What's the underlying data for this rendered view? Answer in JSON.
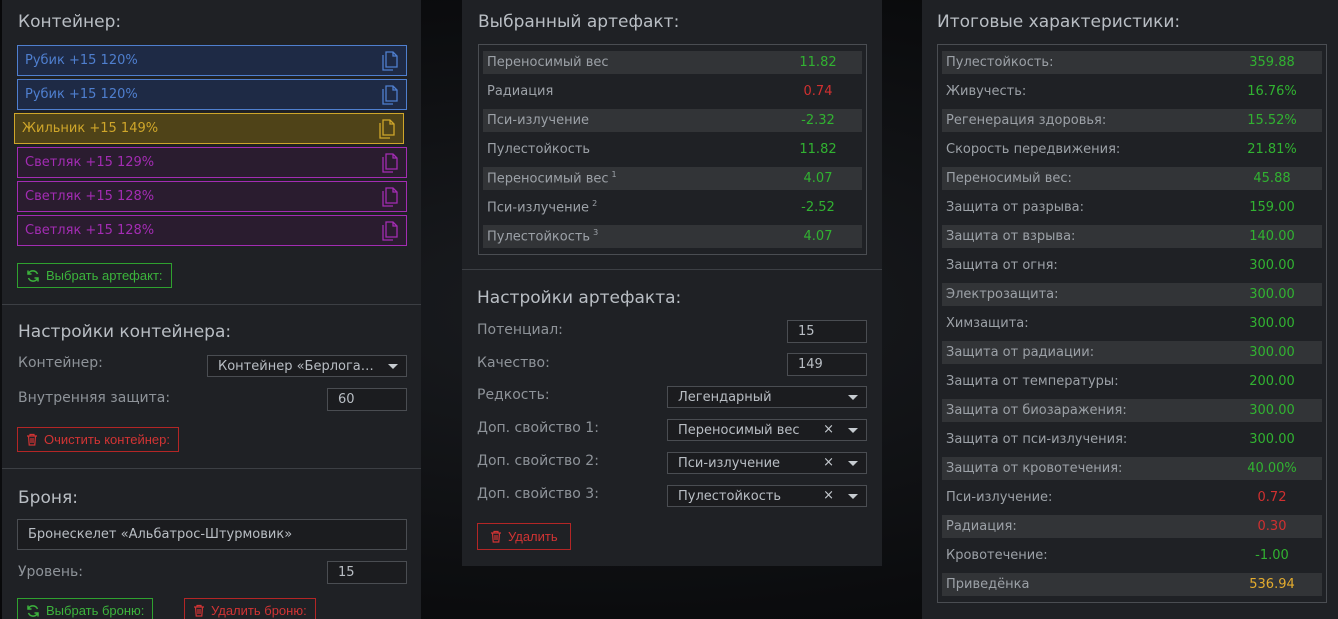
{
  "container": {
    "title": "Контейнер:",
    "artifacts": [
      {
        "label": "Рубик +15 120%",
        "color": "#4f7fcf",
        "bg": "#1e2a45"
      },
      {
        "label": "Рубик +15 120%",
        "color": "#4f7fcf",
        "bg": "#1e2a45"
      },
      {
        "label": "Жильник +15 149%",
        "color": "#cfa62a",
        "bg": "#4f4318"
      },
      {
        "label": "Светляк +15 129%",
        "color": "#a32cb3",
        "bg": "#2a1c2f"
      },
      {
        "label": "Светляк +15 128%",
        "color": "#a32cb3",
        "bg": "#2a1c2f"
      },
      {
        "label": "Светляк +15 128%",
        "color": "#a32cb3",
        "bg": "#2a1c2f"
      }
    ],
    "choose_artifact_label": "Выбрать артефакт:"
  },
  "container_settings": {
    "title": "Настройки контейнера:",
    "container_label": "Контейнер:",
    "container_value": "Контейнер «Берлога…",
    "inner_protection_label": "Внутренняя защита:",
    "inner_protection_value": "60",
    "clear_label": "Очистить контейнер:"
  },
  "armor": {
    "title": "Броня:",
    "name_value": "Бронескелет «Альбатрос-Штурмовик»",
    "level_label": "Уровень:",
    "level_value": "15",
    "choose_label": "Выбрать броню:",
    "delete_label": "Удалить броню:"
  },
  "selected": {
    "title": "Выбранный артефакт:",
    "rows": [
      {
        "key": "Переносимый вес",
        "sup": "",
        "value": "11.82",
        "tone": "green"
      },
      {
        "key": "Радиация",
        "sup": "",
        "value": "0.74",
        "tone": "red"
      },
      {
        "key": "Пси-излучение",
        "sup": "",
        "value": "-2.32",
        "tone": "green"
      },
      {
        "key": "Пулестойкость",
        "sup": "",
        "value": "11.82",
        "tone": "green"
      },
      {
        "key": "Переносимый вес",
        "sup": "1",
        "value": "4.07",
        "tone": "green"
      },
      {
        "key": "Пси-излучение",
        "sup": "2",
        "value": "-2.52",
        "tone": "green"
      },
      {
        "key": "Пулестойкость",
        "sup": "3",
        "value": "4.07",
        "tone": "green"
      }
    ]
  },
  "art_settings": {
    "title": "Настройки артефакта:",
    "potential_label": "Потенциал:",
    "potential_value": "15",
    "quality_label": "Качество:",
    "quality_value": "149",
    "rarity_label": "Редкость:",
    "rarity_value": "Легендарный",
    "extra1_label": "Доп. свойство 1:",
    "extra1_value": "Переносимый вес",
    "extra2_label": "Доп. свойство 2:",
    "extra2_value": "Пси-излучение",
    "extra3_label": "Доп. свойство 3:",
    "extra3_value": "Пулестойкость",
    "clear_glyph": "×",
    "delete_label": "Удалить"
  },
  "totals": {
    "title": "Итоговые характеристики:",
    "rows": [
      {
        "key": "Пулестойкость:",
        "value": "359.88",
        "tone": "green"
      },
      {
        "key": "Живучесть:",
        "value": "16.76%",
        "tone": "green"
      },
      {
        "key": "Регенерация здоровья:",
        "value": "15.52%",
        "tone": "green"
      },
      {
        "key": "Скорость передвижения:",
        "value": "21.81%",
        "tone": "green"
      },
      {
        "key": "Переносимый вес:",
        "value": "45.88",
        "tone": "green"
      },
      {
        "key": "Защита от разрыва:",
        "value": "159.00",
        "tone": "green"
      },
      {
        "key": "Защита от взрыва:",
        "value": "140.00",
        "tone": "green"
      },
      {
        "key": "Защита от огня:",
        "value": "300.00",
        "tone": "green"
      },
      {
        "key": "Электрозащита:",
        "value": "300.00",
        "tone": "green"
      },
      {
        "key": "Химзащита:",
        "value": "300.00",
        "tone": "green"
      },
      {
        "key": "Защита от радиации:",
        "value": "300.00",
        "tone": "green"
      },
      {
        "key": "Защита от температуры:",
        "value": "200.00",
        "tone": "green"
      },
      {
        "key": "Защита от биозаражения:",
        "value": "300.00",
        "tone": "green"
      },
      {
        "key": "Защита от пси-излучения:",
        "value": "300.00",
        "tone": "green"
      },
      {
        "key": "Защита от кровотечения:",
        "value": "40.00%",
        "tone": "green"
      },
      {
        "key": "Пси-излучение:",
        "value": "0.72",
        "tone": "red"
      },
      {
        "key": "Радиация:",
        "value": "0.30",
        "tone": "red"
      },
      {
        "key": "Кровотечение:",
        "value": "-1.00",
        "tone": "green"
      },
      {
        "key": "Приведёнка",
        "value": "536.94",
        "tone": "gold"
      }
    ]
  },
  "icons": {
    "artifact_card": "copy-cards-icon",
    "refresh": "refresh-icon",
    "trash": "trash-icon"
  }
}
